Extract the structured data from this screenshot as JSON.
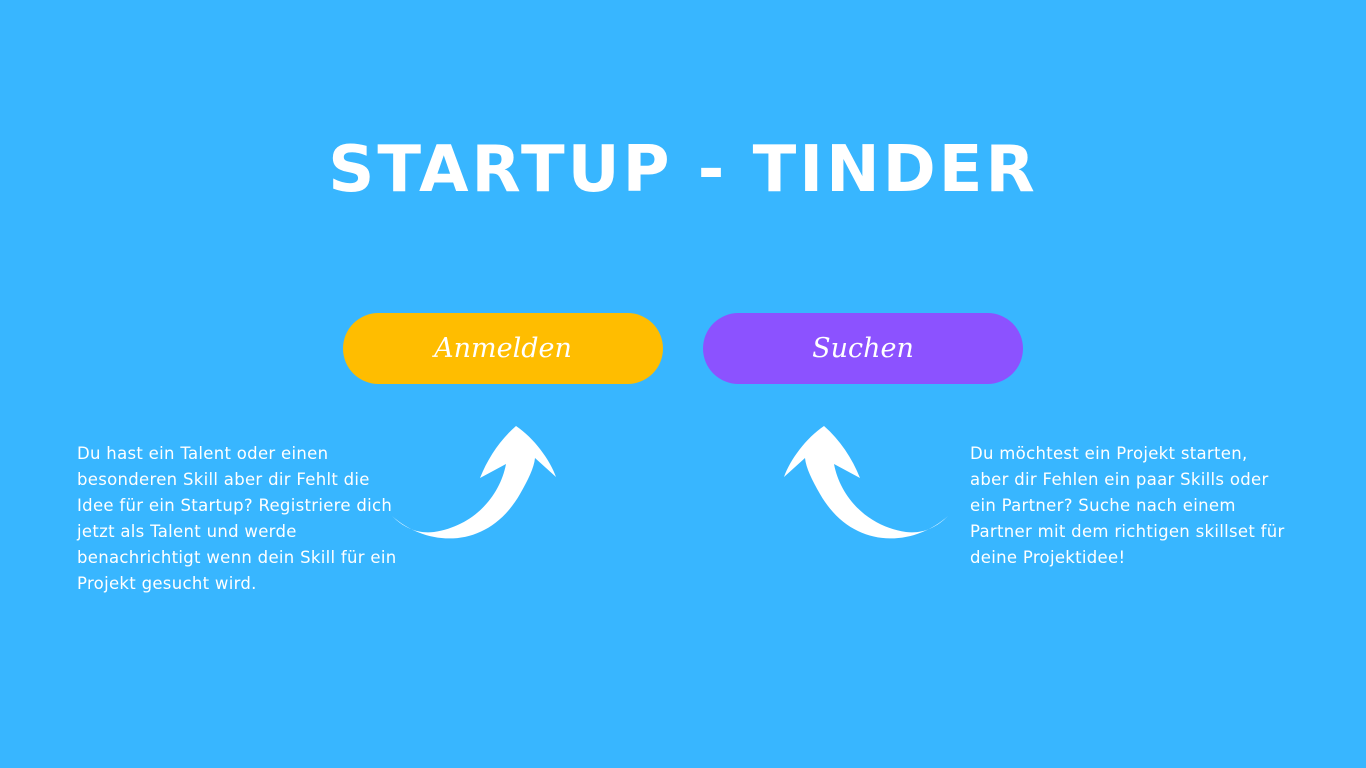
{
  "header": {
    "title": "STARTUP - TINDER"
  },
  "actions": {
    "register_label": "Anmelden",
    "search_label": "Suchen"
  },
  "descriptions": {
    "talent": "Du hast ein Talent oder einen besonderen Skill aber dir Fehlt die Idee für ein Startup? Registriere dich jetzt als Talent und werde benachrichtigt wenn dein Skill für ein Projekt gesucht wird.",
    "founder": "Du möchtest ein Projekt starten, aber dir Fehlen ein paar Skills oder ein Partner? Suche nach einem Partner mit dem richtigen skillset für deine Projektidee!"
  },
  "icons": {
    "left_arrow": "curved-arrow-up-right-icon",
    "right_arrow": "curved-arrow-up-left-icon"
  },
  "colors": {
    "background": "#38B6FF",
    "register_button": "#FFBD00",
    "search_button": "#8C52FF",
    "text": "#FFFFFF"
  }
}
